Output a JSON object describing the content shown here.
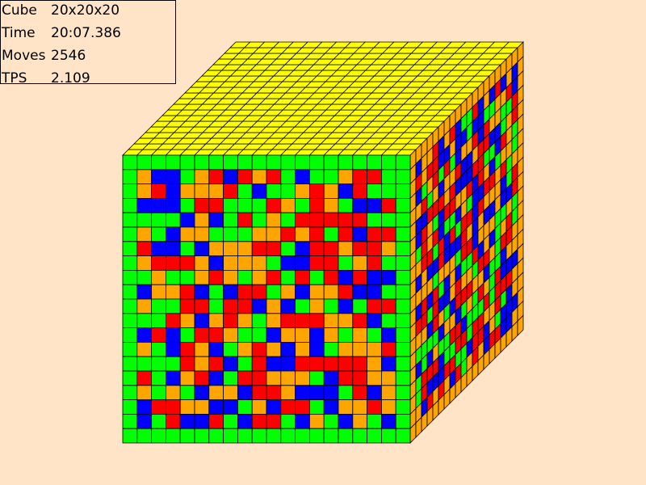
{
  "stats": {
    "cube_label": "Cube",
    "cube_value": "20x20x20",
    "time_label": "Time",
    "time_value": "20:07.386",
    "moves_label": "Moves",
    "moves_value": "2546",
    "tps_label": "TPS",
    "tps_value": "2.109"
  },
  "cube": {
    "size": 20,
    "colors": {
      "top": "#FFFF00",
      "front": "#00FF00",
      "green": "#00FF00",
      "red": "#FF0000",
      "blue": "#0000FF",
      "orange": "#FFA500",
      "background": "#FFE4C8"
    }
  }
}
